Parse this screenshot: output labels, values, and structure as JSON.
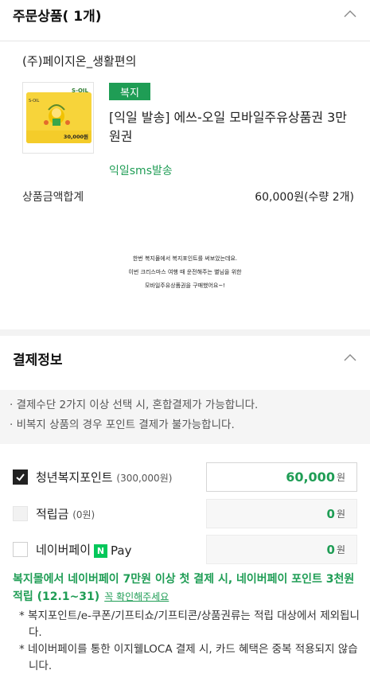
{
  "order": {
    "title": "주문상품( 1개)",
    "seller": "(주)페이지온_생활편의",
    "product": {
      "badge": "복지",
      "name": "[익일 발송] 에쓰-오일 모바일주유상품권 3만원권",
      "delivery": "익일sms발송",
      "card_brand": "S-OIL",
      "card_amount": "30,000원"
    },
    "summary_label": "상품금액합계",
    "summary_value": "60,000원(수량 2개)",
    "note_lines": [
      "한번 복지몰에서 복지포인트를 써보았는데요.",
      "이번 크리스마스 여행 때 운전해주는 별님을 위한",
      "모바일주유상품권을 구매했어요~!"
    ]
  },
  "payment": {
    "title": "결제정보",
    "info": [
      "· 결제수단 2가지 이상 선택 시, 혼합결제가 가능합니다.",
      "· 비복지 상품의 경우 포인트 결제가 불가능합니다."
    ],
    "rows": [
      {
        "label": "청년복지포인트",
        "sub": "(300,000원)",
        "amount": "60,000",
        "unit": "원",
        "checked": true
      },
      {
        "label": "적립금",
        "sub": "(0원)",
        "amount": "0",
        "unit": "원",
        "checked": false
      },
      {
        "label": "네이버페이",
        "npay_logo": "N",
        "npay_text": "Pay",
        "amount": "0",
        "unit": "원",
        "checked": false
      }
    ],
    "promo": "복지몰에서 네이버페이 7만원 이상 첫 결제 시, 네이버페이 포인트 3천원 적립 (12.1~31)",
    "promo_link": "꼭 확인해주세요",
    "fine_print": [
      "* 복지포인트/e-쿠폰/기프티쇼/기프티콘/상품권류는 적립 대상에서 제외됩니다.",
      "* 네이버페이를 통한 이지웰LOCA 결제 시, 카드 혜택은 중복 적용되지 않습니다."
    ]
  },
  "colors": {
    "accent": "#1f9d55",
    "npay": "#03c75a"
  },
  "icons": {
    "collapse": "chevron-up-icon",
    "check": "checkmark-icon"
  }
}
